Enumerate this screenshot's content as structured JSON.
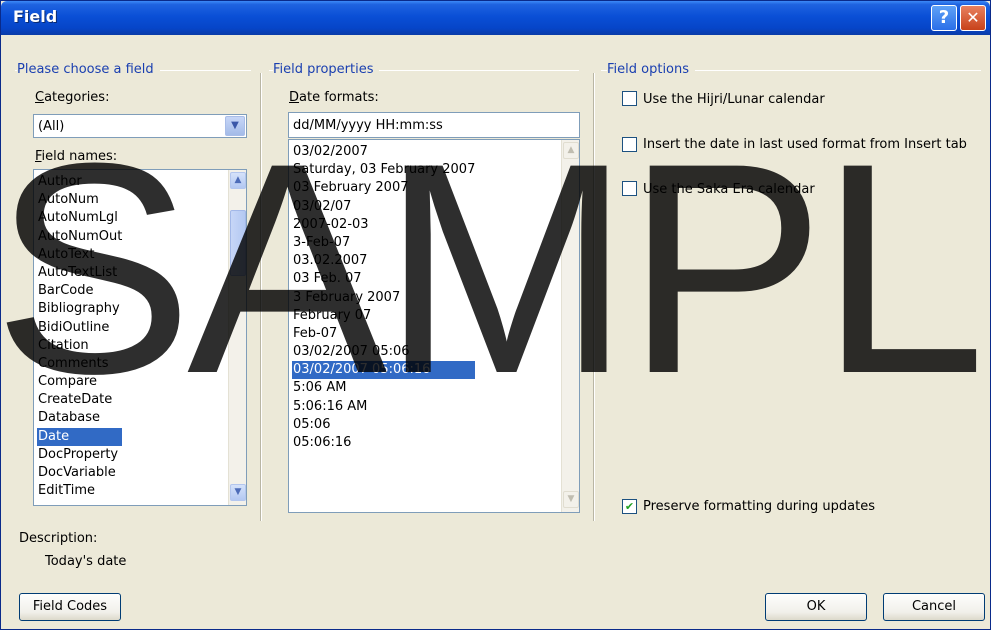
{
  "window": {
    "title": "Field",
    "help_glyph": "?",
    "close_glyph": "✕"
  },
  "field_chooser": {
    "group_title": "Please choose a field",
    "categories_label": "Categories:",
    "category_value": "(All)",
    "field_names_label": "Field names:",
    "field_names": [
      "Author",
      "AutoNum",
      "AutoNumLgl",
      "AutoNumOut",
      "AutoText",
      "AutoTextList",
      "BarCode",
      "Bibliography",
      "BidiOutline",
      "Citation",
      "Comments",
      "Compare",
      "CreateDate",
      "Database",
      "Date",
      "DocProperty",
      "DocVariable",
      "EditTime"
    ],
    "selected_field": "Date"
  },
  "field_properties": {
    "group_title": "Field properties",
    "date_formats_label": "Date formats:",
    "date_format_value": "dd/MM/yyyy HH:mm:ss",
    "formats": [
      "03/02/2007",
      "Saturday, 03 February 2007",
      "03 February 2007",
      "03/02/07",
      "2007-02-03",
      "3-Feb-07",
      "03.02.2007",
      "03 Feb. 07",
      "3 February 2007",
      "February 07",
      "Feb-07",
      "03/02/2007 05:06",
      "03/02/2007 05:06:16",
      "5:06 AM",
      "5:06:16 AM",
      "05:06",
      "05:06:16"
    ],
    "selected_format": "03/02/2007 05:06:16"
  },
  "field_options": {
    "group_title": "Field options",
    "use_hijri": {
      "label": "Use the Hijri/Lunar calendar",
      "checked": false
    },
    "insert_last_format": {
      "label": "Insert the date in last used format from Insert tab",
      "checked": false
    },
    "use_saka": {
      "label": "Use the Saka Era calendar",
      "checked": false
    },
    "preserve_formatting": {
      "label": "Preserve formatting during updates",
      "checked": true
    }
  },
  "description": {
    "label": "Description:",
    "text": "Today's date"
  },
  "buttons": {
    "field_codes": "Field Codes",
    "ok": "OK",
    "cancel": "Cancel"
  },
  "watermark": "SAMPL"
}
